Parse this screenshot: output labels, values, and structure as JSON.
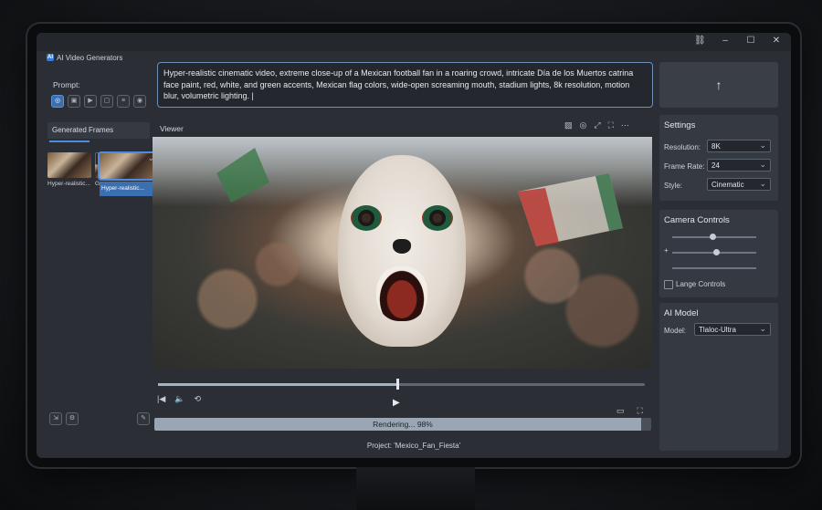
{
  "app": {
    "title": "AI Video Generators",
    "logo": "AI"
  },
  "window_controls": [
    "link-icon",
    "minimize-icon",
    "maximize-icon",
    "close-icon"
  ],
  "prompt": {
    "label": "Prompt:",
    "text": "Hyper-realistic cinematic video, extreme close-up of a Mexican football fan in a roaring crowd, intricate Día de los Muertos catrina face paint, red, white, and green accents, Mexican flag colors, wide-open screaming mouth, stadium lights, 8k resolution, motion blur, volumetric lighting. |"
  },
  "upload_button": "↑",
  "generated_frames": {
    "title": "Generated Frames",
    "items": [
      {
        "label": "Hyper-realistic..."
      },
      {
        "label": "Hyper-realistic..."
      },
      {
        "label": "Ger"
      }
    ]
  },
  "viewer": {
    "title": "Viewer"
  },
  "rendering": {
    "text": "Rendering... 98%",
    "progress": 0.98
  },
  "timeline": {
    "position": 0.49
  },
  "project": "Project: 'Mexico_Fan_Fiesta'",
  "settings": {
    "title": "Settings",
    "resolution_label": "Resolution:",
    "resolution": "8K",
    "frame_rate_label": "Frame Rate:",
    "frame_rate": "24",
    "style_label": "Style:",
    "style": "Cinematic"
  },
  "camera": {
    "title": "Camera Controls",
    "plus": "+",
    "slider_values": [
      0.48,
      0.52,
      0.5
    ],
    "checkbox_label": "Lange Controls"
  },
  "ai_model": {
    "title": "AI Model",
    "model_label": "Model:",
    "model": "Tlaloc-Ultra"
  },
  "colors": {
    "accent": "#4f8be0",
    "panel": "#353a42",
    "bg": "#2b2f35"
  }
}
